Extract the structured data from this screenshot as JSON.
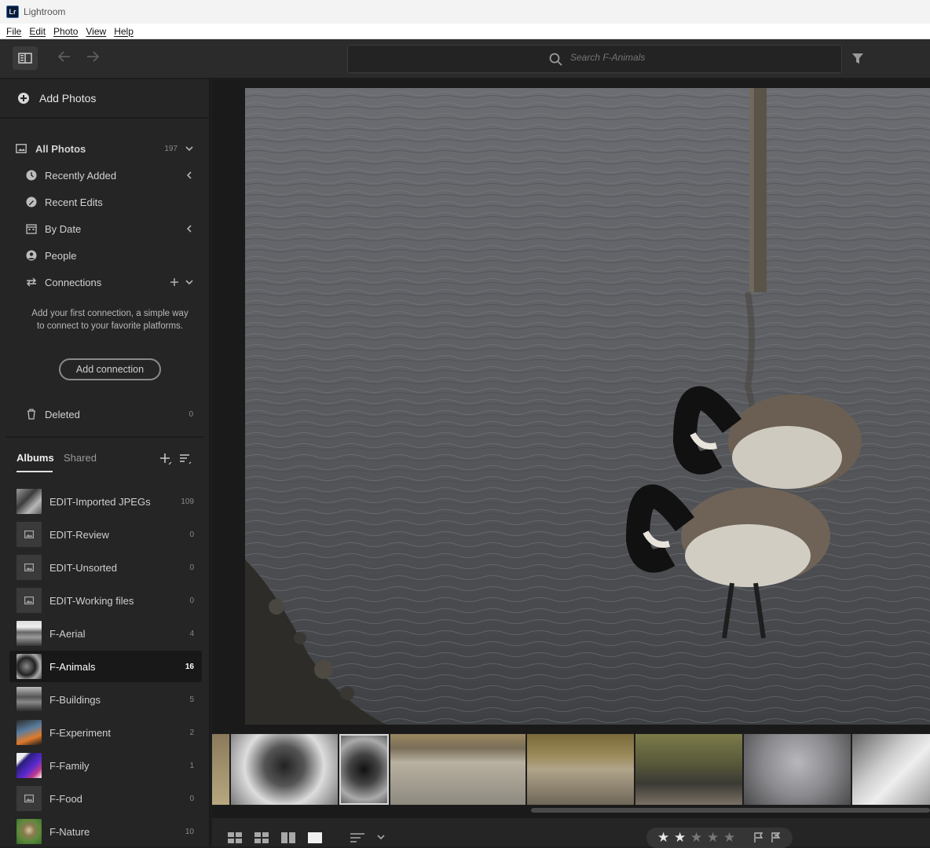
{
  "window": {
    "title": "Lightroom",
    "logo_text": "Lr"
  },
  "menu": {
    "items": [
      "File",
      "Edit",
      "Photo",
      "View",
      "Help"
    ]
  },
  "search": {
    "placeholder": "Search F-Animals"
  },
  "sidebar": {
    "add_photos": "Add Photos",
    "all_photos": {
      "label": "All Photos",
      "count": "197"
    },
    "items": [
      {
        "label": "Recently Added"
      },
      {
        "label": "Recent Edits"
      },
      {
        "label": "By Date"
      },
      {
        "label": "People"
      },
      {
        "label": "Connections"
      }
    ],
    "connection_text": "Add your first connection, a simple way to connect to your favorite platforms.",
    "add_connection": "Add connection",
    "deleted": {
      "label": "Deleted",
      "count": "0"
    },
    "tabs": {
      "albums": "Albums",
      "shared": "Shared"
    },
    "albums": [
      {
        "name": "EDIT-Imported JPEGs",
        "count": "109"
      },
      {
        "name": "EDIT-Review",
        "count": "0"
      },
      {
        "name": "EDIT-Unsorted",
        "count": "0"
      },
      {
        "name": "EDIT-Working files",
        "count": "0"
      },
      {
        "name": "F-Aerial",
        "count": "4"
      },
      {
        "name": "F-Animals",
        "count": "16"
      },
      {
        "name": "F-Buildings",
        "count": "5"
      },
      {
        "name": "F-Experiment",
        "count": "2"
      },
      {
        "name": "F-Family",
        "count": "1"
      },
      {
        "name": "F-Food",
        "count": "0"
      },
      {
        "name": "F-Nature",
        "count": "10"
      }
    ]
  },
  "rating": {
    "stars": 2,
    "max": 5
  },
  "colors": {
    "accent": "#e0e0e0",
    "panel": "#252525",
    "toolbar": "#2b2b2b"
  }
}
